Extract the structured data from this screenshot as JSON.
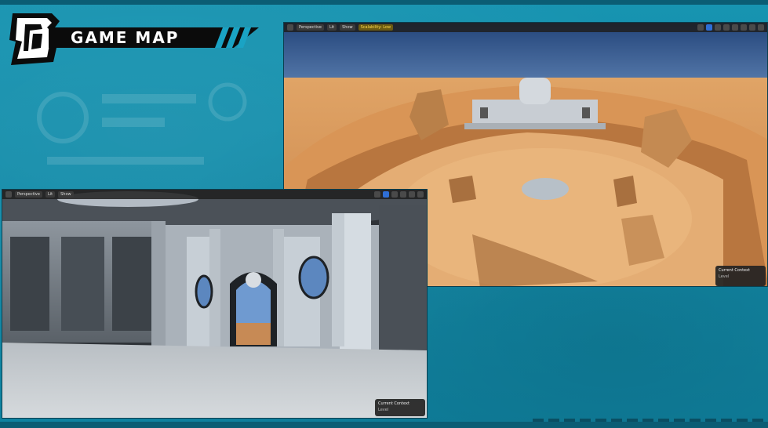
{
  "header": {
    "title": "GAME MAP"
  },
  "viewport_main": {
    "toolbar": {
      "perspective_label": "Perspective",
      "lit_label": "Lit",
      "show_label": "Show",
      "warning_label": "Scalability: Low"
    },
    "current_context": {
      "title": "Current Context",
      "level_label": "Level"
    }
  },
  "viewport_interior": {
    "toolbar": {
      "perspective_label": "Perspective",
      "lit_label": "Lit",
      "show_label": "Show"
    },
    "current_context": {
      "title": "Current Context",
      "level_label": "Level"
    }
  },
  "colors": {
    "background": "#138aa6",
    "banner": "#0b0b0b",
    "sky": "#2b4f86",
    "sand": "#d79a5c",
    "interior_wall": "#bcc4cc"
  }
}
